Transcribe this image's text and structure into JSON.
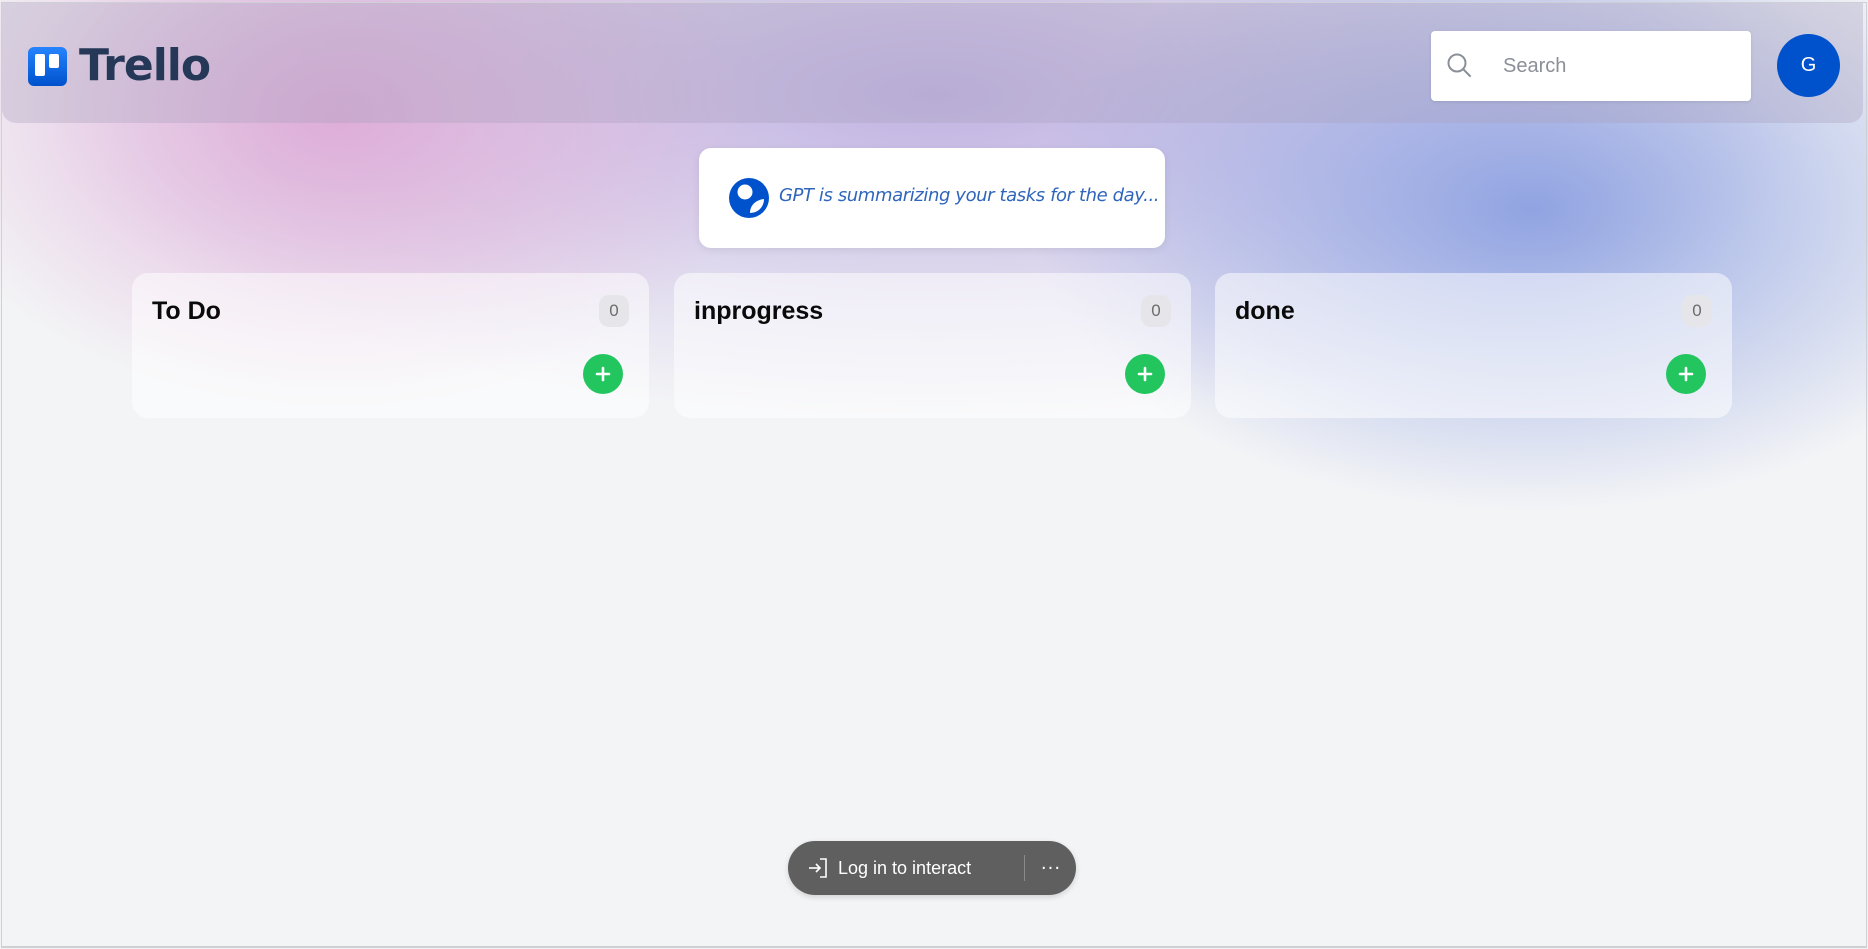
{
  "app": {
    "name": "Trello"
  },
  "header": {
    "search_placeholder": "Search",
    "avatar_initial": "G"
  },
  "gpt_banner": {
    "text": "GPT is summarizing your tasks for the day..."
  },
  "columns": [
    {
      "title": "To Do",
      "count": "0"
    },
    {
      "title": "inprogress",
      "count": "0"
    },
    {
      "title": "done",
      "count": "0"
    }
  ],
  "footer_pill": {
    "login_label": "Log in to interact",
    "more_label": "···"
  },
  "colors": {
    "brand_blue": "#0052cc",
    "add_green": "#22c55e",
    "logo_text": "#253858",
    "gpt_text": "#2f66bb"
  }
}
